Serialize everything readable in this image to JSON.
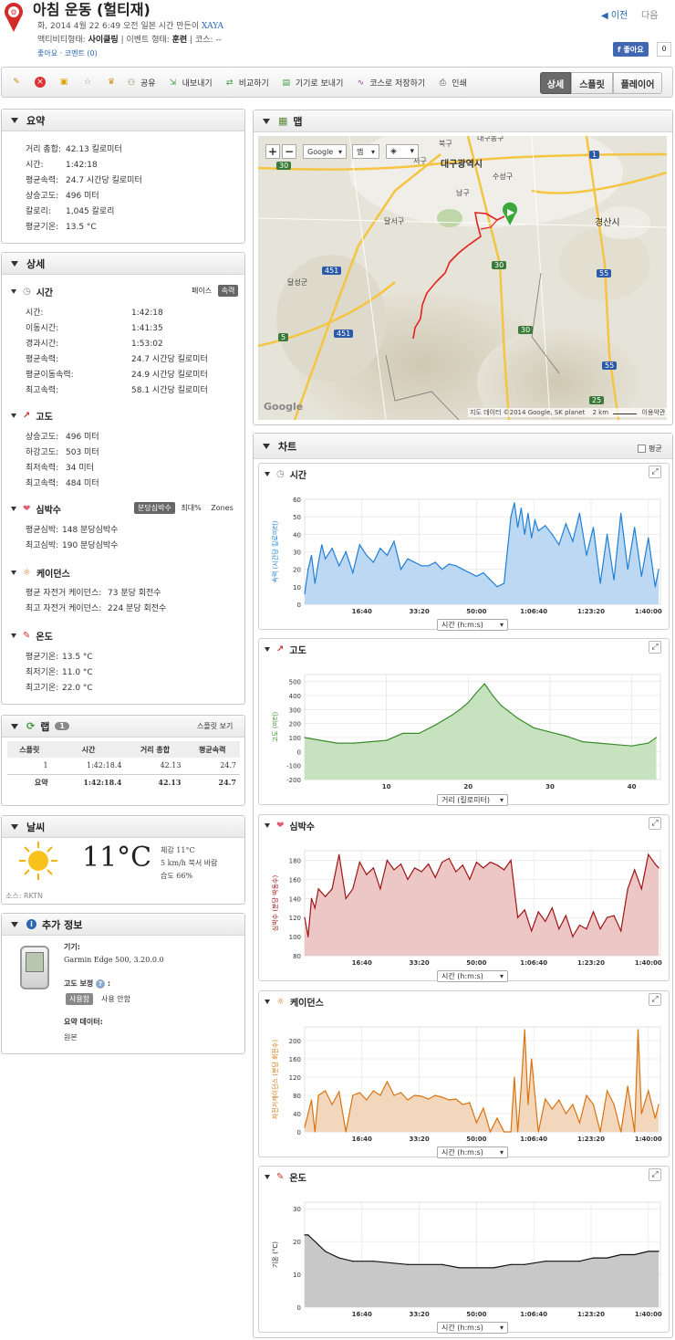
{
  "header": {
    "title": "아침 운동 (헐티재)",
    "meta_line": "화, 2014 4월 22 6:49 오전 일본 시간 만든이",
    "author": "XAYA",
    "activity_type_label": "액티비티형태:",
    "activity_type_value": "사이클링",
    "event_type_label": "| 이벤트 형태:",
    "event_type_value": "훈련",
    "course_label": "| 코스: --",
    "like_link": "좋아요",
    "comment_link": "코멘트 (0)",
    "prev": "이전",
    "next": "다음",
    "fb_like": "좋아요",
    "fb_count": "0"
  },
  "toolbar": {
    "share": "공유",
    "export": "내보내기",
    "compare": "비교하기",
    "send_device": "기기로 보내기",
    "save_course": "코스로 저장하기",
    "print": "인쇄",
    "view_details": "상세",
    "view_splits": "스플릿",
    "view_player": "플레이어"
  },
  "summary": {
    "title": "요약",
    "rows": [
      {
        "label": "거리 총합:",
        "value": "42.13 킬로미터"
      },
      {
        "label": "시간:",
        "value": "1:42:18"
      },
      {
        "label": "평균속력:",
        "value": "24.7 시간당 킬로미터"
      },
      {
        "label": "상승고도:",
        "value": "496 미터"
      },
      {
        "label": "칼로리:",
        "value": "1,045 칼로리"
      },
      {
        "label": "평균기온:",
        "value": "13.5 °C"
      }
    ]
  },
  "details": {
    "title": "상세",
    "time": {
      "title": "시간",
      "toggle_pace": "페이스",
      "toggle_speed": "속력",
      "rows": [
        {
          "label": "시간:",
          "value": "1:42:18"
        },
        {
          "label": "이동시간:",
          "value": "1:41:35"
        },
        {
          "label": "경과시간:",
          "value": "1:53:02"
        },
        {
          "label": "평균속력:",
          "value": "24.7 시간당 킬로미터"
        },
        {
          "label": "평균이동속력:",
          "value": "24.9 시간당 킬로미터"
        },
        {
          "label": "최고속력:",
          "value": "58.1 시간당 킬로미터"
        }
      ]
    },
    "elevation": {
      "title": "고도",
      "rows": [
        {
          "label": "상승고도:",
          "value": "496 미터"
        },
        {
          "label": "하강고도:",
          "value": "503 미터"
        },
        {
          "label": "최저속력:",
          "value": "34 미터"
        },
        {
          "label": "최고속력:",
          "value": "484 미터"
        }
      ]
    },
    "heart": {
      "title": "심박수",
      "toggle_bpm": "분당심박수",
      "toggle_max": "최대%",
      "toggle_zones": "Zones",
      "rows": [
        {
          "label": "평균심박:",
          "value": "148 분당심박수"
        },
        {
          "label": "최고심박:",
          "value": "190 분당심박수"
        }
      ]
    },
    "cadence": {
      "title": "케이던스",
      "rows": [
        {
          "label": "평균 자전거 케이던스:",
          "value": "73 분당 회전수"
        },
        {
          "label": "최고 자전거 케이던스:",
          "value": "224 분당 회전수"
        }
      ]
    },
    "temperature": {
      "title": "온도",
      "rows": [
        {
          "label": "평균기온:",
          "value": "13.5 °C"
        },
        {
          "label": "최저기온:",
          "value": "11.0 °C"
        },
        {
          "label": "최고기온:",
          "value": "22.0 °C"
        }
      ]
    }
  },
  "laps": {
    "title": "랩",
    "count": "1",
    "split_view": "스플릿 보기",
    "headers": [
      "스플릿",
      "시간",
      "거리 총합",
      "평균속력"
    ],
    "rows": [
      [
        "1",
        "1:42:18.4",
        "42.13",
        "24.7"
      ]
    ],
    "summary": [
      "요약",
      "1:42:18.4",
      "42.13",
      "24.7"
    ]
  },
  "weather": {
    "title": "날씨",
    "temp": "11°C",
    "feels": "체감 11°C",
    "wind": "5 km/h 북서 바람",
    "humidity": "습도 66%",
    "source": "소스: RKTN"
  },
  "extra": {
    "title": "추가 정보",
    "device_label": "기기:",
    "device_value": "Garmin Edge 500, 3.20.0.0",
    "elev_corr_label": "고도 보정",
    "elev_on": "사용함",
    "elev_off": "사용 안함",
    "summary_data_label": "요약 데이터:",
    "summary_data_value": "원본"
  },
  "map": {
    "title": "맵",
    "provider": "Google",
    "map_type": "맵",
    "attribution": "지도 데이터 ©2014 Google, SK planet",
    "scale": "2 km",
    "terms": "이용약관",
    "labels": {
      "daegu": "대구광역시",
      "gyeongsan": "경산시",
      "bukgu": "북구",
      "namgu": "남구",
      "suseong": "수성구",
      "dalseo": "달서구",
      "dalseong": "달성군",
      "seogu": "서구",
      "dong": "대구동구",
      "r30": "30",
      "r451": "451",
      "r5": "5",
      "r55": "55",
      "r25": "25",
      "r1": "1"
    }
  },
  "charts": {
    "title": "차트",
    "avg_label": "평균",
    "time_axis_label": "시간 (h:m:s)",
    "dist_axis_label": "거리 (킬로미터)",
    "speed_title": "시간",
    "elev_title": "고도",
    "hr_title": "심박수",
    "cad_title": "케이던스",
    "temp_title": "온도"
  },
  "chart_data": [
    {
      "type": "area",
      "title": "시간",
      "ylabel": "속력 (시간당 킬로미터)",
      "xlabel": "시간 (h:m:s)",
      "xticks": [
        "16:40",
        "33:20",
        "50:00",
        "1:06:40",
        "1:23:20",
        "1:40:00"
      ],
      "yticks": [
        0,
        10,
        20,
        30,
        40,
        50,
        60
      ],
      "ylim": [
        0,
        60
      ],
      "x_minutes": [
        0,
        1,
        2,
        3,
        4,
        5,
        6,
        8,
        10,
        12,
        14,
        16,
        18,
        20,
        22,
        24,
        26,
        28,
        30,
        32,
        34,
        36,
        38,
        40,
        42,
        44,
        46,
        48,
        50,
        52,
        54,
        56,
        58,
        60,
        61,
        62,
        63,
        64,
        65,
        66,
        67,
        68,
        70,
        72,
        74,
        76,
        78,
        80,
        82,
        84,
        86,
        88,
        90,
        92,
        94,
        96,
        98,
        100,
        102,
        103
      ],
      "values": [
        6,
        20,
        28,
        12,
        24,
        34,
        26,
        32,
        22,
        30,
        18,
        34,
        28,
        24,
        32,
        28,
        36,
        20,
        26,
        24,
        22,
        22,
        24,
        20,
        23,
        22,
        20,
        18,
        16,
        18,
        14,
        10,
        12,
        50,
        58,
        44,
        55,
        40,
        52,
        38,
        48,
        42,
        45,
        40,
        34,
        46,
        36,
        52,
        28,
        44,
        12,
        40,
        14,
        52,
        20,
        44,
        16,
        38,
        10,
        20
      ],
      "color": "#1f7fd6",
      "fill": "#bcd8f2"
    },
    {
      "type": "area",
      "title": "고도",
      "ylabel": "고도 (미터)",
      "xlabel": "거리 (킬로미터)",
      "xticks": [
        10,
        20,
        30,
        40
      ],
      "yticks": [
        -200,
        -100,
        0,
        100,
        200,
        300,
        400,
        500
      ],
      "ylim": [
        -200,
        550
      ],
      "x": [
        0,
        2,
        4,
        6,
        8,
        10,
        12,
        14,
        16,
        18,
        19,
        20,
        21,
        22,
        23,
        24,
        26,
        28,
        30,
        32,
        34,
        36,
        38,
        40,
        42,
        43
      ],
      "values": [
        100,
        80,
        60,
        60,
        70,
        80,
        130,
        130,
        190,
        260,
        300,
        350,
        420,
        484,
        400,
        330,
        240,
        170,
        140,
        110,
        70,
        60,
        50,
        40,
        60,
        100
      ],
      "color": "#3a8c2a",
      "fill": "#c7e2bf"
    },
    {
      "type": "area",
      "title": "심박수",
      "ylabel": "심박수 (분당 박동수)",
      "xlabel": "시간 (h:m:s)",
      "xticks": [
        "16:40",
        "33:20",
        "50:00",
        "1:06:40",
        "1:23:20",
        "1:40:00"
      ],
      "yticks": [
        80,
        100,
        120,
        140,
        160,
        180
      ],
      "ylim": [
        80,
        190
      ],
      "x_minutes": [
        0,
        1,
        2,
        3,
        4,
        6,
        8,
        10,
        12,
        14,
        16,
        18,
        20,
        22,
        24,
        26,
        28,
        30,
        32,
        34,
        36,
        38,
        40,
        42,
        44,
        46,
        48,
        50,
        52,
        54,
        56,
        58,
        60,
        62,
        64,
        66,
        68,
        70,
        72,
        74,
        76,
        78,
        80,
        82,
        84,
        86,
        88,
        90,
        92,
        94,
        96,
        98,
        100,
        102,
        103
      ],
      "values": [
        120,
        100,
        140,
        130,
        150,
        142,
        150,
        186,
        140,
        150,
        178,
        165,
        172,
        150,
        180,
        170,
        176,
        160,
        172,
        168,
        176,
        162,
        178,
        182,
        168,
        175,
        160,
        178,
        172,
        178,
        175,
        170,
        180,
        120,
        128,
        106,
        126,
        116,
        130,
        108,
        122,
        100,
        112,
        108,
        126,
        108,
        120,
        122,
        106,
        150,
        170,
        150,
        186,
        176,
        172
      ],
      "color": "#a11414",
      "fill": "#edc6c6"
    },
    {
      "type": "area",
      "title": "케이던스",
      "ylabel": "자전거케이던스 (분당 회전수)",
      "xlabel": "시간 (h:m:s)",
      "xticks": [
        "16:40",
        "33:20",
        "50:00",
        "1:06:40",
        "1:23:20",
        "1:40:00"
      ],
      "yticks": [
        0,
        40,
        80,
        120,
        160,
        200
      ],
      "ylim": [
        0,
        230
      ],
      "x_minutes": [
        0,
        1,
        2,
        3,
        4,
        6,
        8,
        10,
        12,
        14,
        16,
        18,
        20,
        22,
        24,
        26,
        28,
        30,
        32,
        34,
        36,
        38,
        40,
        42,
        44,
        46,
        48,
        50,
        52,
        54,
        56,
        58,
        60,
        61,
        62,
        63,
        64,
        65,
        66,
        68,
        70,
        72,
        74,
        76,
        78,
        80,
        82,
        84,
        86,
        88,
        90,
        92,
        94,
        96,
        97,
        98,
        100,
        102,
        103
      ],
      "values": [
        10,
        40,
        70,
        0,
        80,
        90,
        60,
        88,
        0,
        80,
        86,
        70,
        90,
        80,
        110,
        80,
        86,
        70,
        80,
        78,
        72,
        80,
        76,
        70,
        72,
        60,
        64,
        20,
        52,
        0,
        30,
        0,
        0,
        120,
        0,
        100,
        224,
        60,
        160,
        0,
        72,
        50,
        70,
        40,
        60,
        20,
        80,
        60,
        0,
        90,
        60,
        0,
        100,
        0,
        224,
        40,
        90,
        30,
        60
      ],
      "color": "#d8730f",
      "fill": "#f3d7bd"
    },
    {
      "type": "area",
      "title": "온도",
      "ylabel": "기온 (°C)",
      "xlabel": "시간 (h:m:s)",
      "xticks": [
        "16:40",
        "33:20",
        "50:00",
        "1:06:40",
        "1:23:20",
        "1:40:00"
      ],
      "yticks": [
        0,
        10,
        20,
        30
      ],
      "ylim": [
        0,
        32
      ],
      "x_minutes": [
        0,
        1,
        2,
        4,
        6,
        8,
        10,
        14,
        20,
        30,
        40,
        45,
        55,
        60,
        64,
        70,
        80,
        84,
        88,
        92,
        96,
        100,
        103
      ],
      "values": [
        22,
        22,
        21,
        19,
        17,
        16,
        15,
        14,
        14,
        13,
        13,
        12,
        12,
        13,
        13,
        14,
        14,
        15,
        15,
        16,
        16,
        17,
        17
      ],
      "color": "#111111",
      "fill": "#c8c8c8"
    }
  ]
}
